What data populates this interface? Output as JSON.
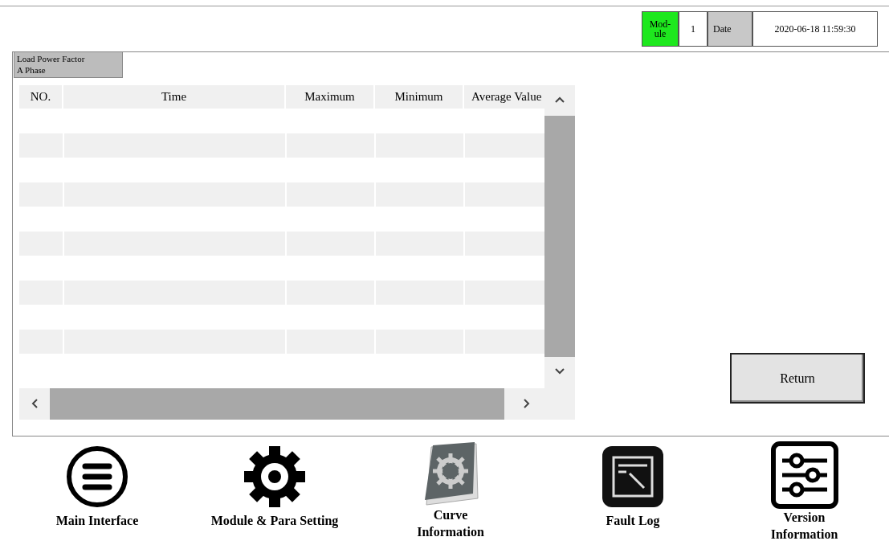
{
  "header": {
    "module_label": "Mod-ule",
    "module_value": "1",
    "date_label": "Date",
    "date_value": "2020-06-18 11:59:30"
  },
  "panel": {
    "tab": "Load Power Factor A Phase",
    "table": {
      "columns": [
        "NO.",
        "Time",
        "Maximum",
        "Minimum",
        "Average Value"
      ]
    },
    "return_button": "Return"
  },
  "nav": [
    {
      "label": "Main Interface"
    },
    {
      "label": "Module & Para Setting"
    },
    {
      "label": "Curve Information"
    },
    {
      "label": "Fault Log"
    },
    {
      "label": "Version Information"
    }
  ]
}
